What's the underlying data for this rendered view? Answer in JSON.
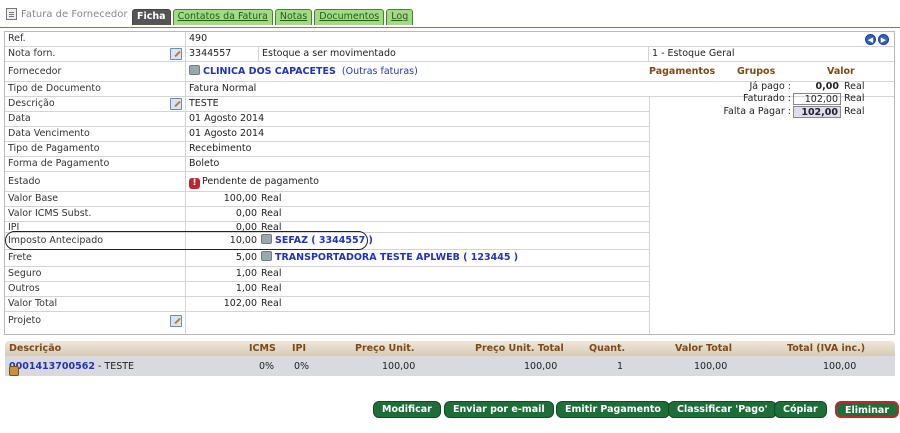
{
  "header": {
    "title": "Fatura de Fornecedor",
    "tabs": [
      "Ficha",
      "Contatos da Fatura",
      "Notas",
      "Documentos",
      "Log"
    ],
    "active_tab": "Ficha"
  },
  "fields": {
    "ref": {
      "label": "Ref.",
      "value": "490"
    },
    "nota": {
      "label": "Nota forn.",
      "value": "3344557",
      "status": "Estoque a ser movimentado",
      "warehouse": "1 - Estoque Geral"
    },
    "fornecedor": {
      "label": "Fornecedor",
      "name": "CLINICA DOS CAPACETES",
      "other": "(Outras faturas)"
    },
    "tipo_doc": {
      "label": "Tipo de Documento",
      "value": "Fatura Normal"
    },
    "descricao": {
      "label": "Descrição",
      "value": "TESTE"
    },
    "data": {
      "label": "Data",
      "value": "01 Agosto 2014"
    },
    "vencimento": {
      "label": "Data Vencimento",
      "value": "01 Agosto 2014"
    },
    "tipo_pag": {
      "label": "Tipo de Pagamento",
      "value": "Recebimento"
    },
    "forma_pag": {
      "label": "Forma de Pagamento",
      "value": "Boleto"
    },
    "estado": {
      "label": "Estado",
      "value": "Pendente de pagamento"
    },
    "valor_base": {
      "label": "Valor Base",
      "value": "100,00",
      "unit": "Real"
    },
    "icms_subst": {
      "label": "Valor ICMS Subst.",
      "value": "0,00",
      "unit": "Real"
    },
    "ipi": {
      "label": "IPI",
      "value": "0,00",
      "unit": "Real"
    },
    "imposto": {
      "label": "Imposto Antecipado",
      "value": "10,00",
      "link": "SEFAZ ( 3344557 )"
    },
    "frete": {
      "label": "Frete",
      "value": "5,00",
      "link": "TRANSPORTADORA TESTE APLWEB ( 123445 )"
    },
    "seguro": {
      "label": "Seguro",
      "value": "1,00",
      "unit": "Real"
    },
    "outros": {
      "label": "Outros",
      "value": "1,00",
      "unit": "Real"
    },
    "total": {
      "label": "Valor Total",
      "value": "102,00",
      "unit": "Real"
    },
    "projeto": {
      "label": "Projeto",
      "value": ""
    }
  },
  "payments": {
    "headers": [
      "Pagamentos",
      "Grupos",
      "Valor"
    ],
    "rows": [
      {
        "label": "Já pago :",
        "value": "0,00",
        "unit": "Real"
      },
      {
        "label": "Faturado :",
        "value": "102,00",
        "unit": "Real"
      },
      {
        "label": "Falta a Pagar :",
        "value": "102,00",
        "unit": "Real"
      }
    ]
  },
  "lines": {
    "headers": [
      "Descrição",
      "ICMS",
      "IPI",
      "Preço Unit.",
      "Preço Unit. Total",
      "Quant.",
      "Valor Total",
      "Total (IVA inc.)"
    ],
    "rows": [
      {
        "code": "0001413700562",
        "desc": "- TESTE",
        "icms": "0%",
        "ipi": "0%",
        "price": "100,00",
        "price_total": "100,00",
        "qty": "1",
        "value_total": "100,00",
        "total_iva": "100,00"
      }
    ]
  },
  "actions": [
    "Modificar",
    "Enviar por e-mail",
    "Emitir Pagamento",
    "Classificar 'Pago'",
    "Cópiar",
    "Eliminar"
  ]
}
